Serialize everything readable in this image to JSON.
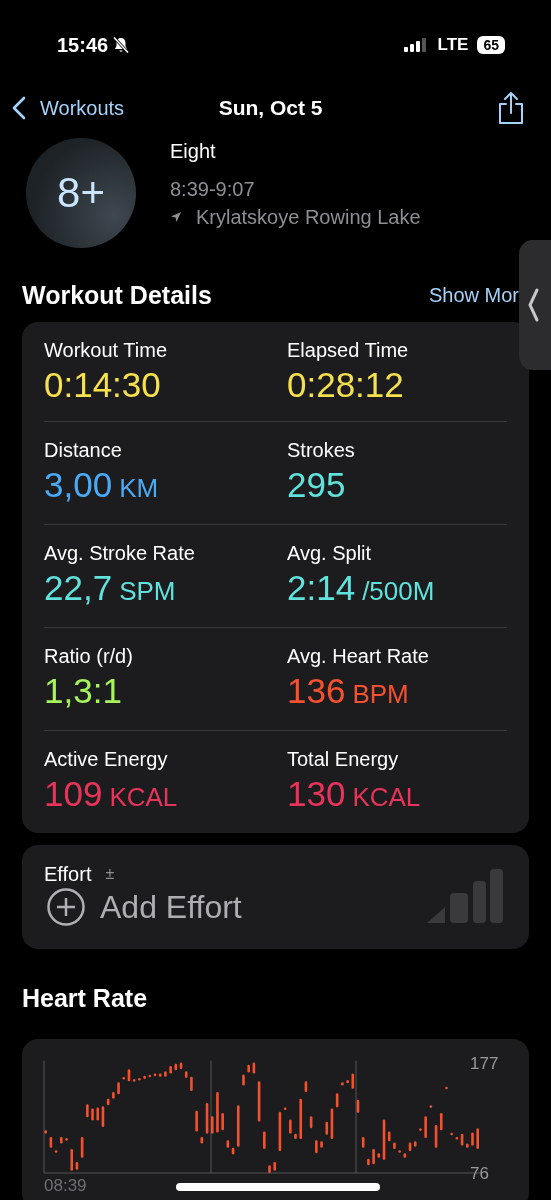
{
  "status_bar": {
    "time": "15:46",
    "network": "LTE",
    "battery": "65"
  },
  "nav": {
    "back": "Workouts",
    "title": "Sun, Oct 5"
  },
  "workout": {
    "badge": "8+",
    "name": "Eight",
    "time_range": "8:39-9:07",
    "location": "Krylatskoye Rowing Lake"
  },
  "details": {
    "title": "Workout Details",
    "link": "Show Mor",
    "metrics": [
      {
        "label": "Workout Time",
        "value": "0:14:30",
        "color": "#f6e04e"
      },
      {
        "label": "Elapsed Time",
        "value": "0:28:12",
        "color": "#f6e04e"
      },
      {
        "label": "Distance",
        "value": "3,00",
        "unit": "KM",
        "color": "#4aaaf4"
      },
      {
        "label": "Strokes",
        "value": "295",
        "color": "#60e2dd"
      },
      {
        "label": "Avg. Stroke Rate",
        "value": "22,7",
        "unit": "SPM",
        "color": "#60e2dd"
      },
      {
        "label": "Avg. Split",
        "value": "2:14",
        "unit": "/500M",
        "color": "#60e2dd"
      },
      {
        "label": "Ratio (r/d)",
        "value": "1,3:1",
        "color": "#a6f35c"
      },
      {
        "label": "Avg. Heart Rate",
        "value": "136",
        "unit": "BPM",
        "color": "#f5512f"
      },
      {
        "label": "Active Energy",
        "value": "109",
        "unit": "KCAL",
        "color": "#e8335a"
      },
      {
        "label": "Total Energy",
        "value": "130",
        "unit": "KCAL",
        "color": "#e8335a"
      }
    ]
  },
  "effort": {
    "label": "Effort",
    "sign": "±",
    "action": "Add Effort"
  },
  "heart_rate": {
    "title": "Heart Rate",
    "y_axis_labels": [
      "177",
      "76"
    ],
    "x_axis_labels": [
      "08:39"
    ]
  }
}
